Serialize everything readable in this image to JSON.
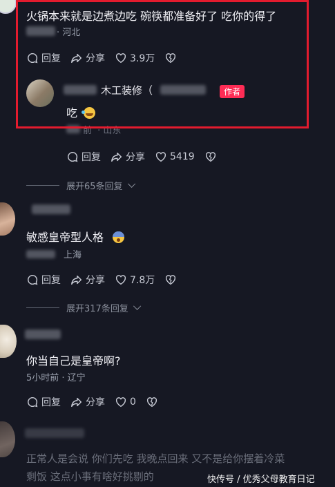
{
  "comment1": {
    "text": "火锅本来就是边煮边吃 碗筷都准备好了 吃你的得了",
    "meta_location": "· 河北",
    "reply": "回复",
    "share": "分享",
    "likes": "3.9万"
  },
  "reply1": {
    "name": "木工装修（",
    "badge": "作者",
    "text": "吃",
    "meta_time": "前",
    "meta_location": "· 山东",
    "reply": "回复",
    "share": "分享",
    "likes": "5419"
  },
  "expand1": {
    "label": "展开65条回复"
  },
  "comment2": {
    "text": "敏感皇帝型人格",
    "meta_location": "上海",
    "reply": "回复",
    "share": "分享",
    "likes": "7.8万"
  },
  "expand2": {
    "label": "展开317条回复"
  },
  "comment3": {
    "text": "你当自己是皇帝啊?",
    "meta": "5小时前 · 辽宁",
    "reply": "回复",
    "share": "分享",
    "likes": "0"
  },
  "comment4": {
    "text_line1": "正常人是会说 你们先吃 我晚点回来 又不是给你摆着冷菜",
    "text_line2": "剩饭 这点小事有啥好挑剔的"
  },
  "watermark": "快传号 / 优秀父母教育日记",
  "colors": {
    "accent": "#fe2c55",
    "highlight": "#e31b2e",
    "background": "#161823"
  }
}
